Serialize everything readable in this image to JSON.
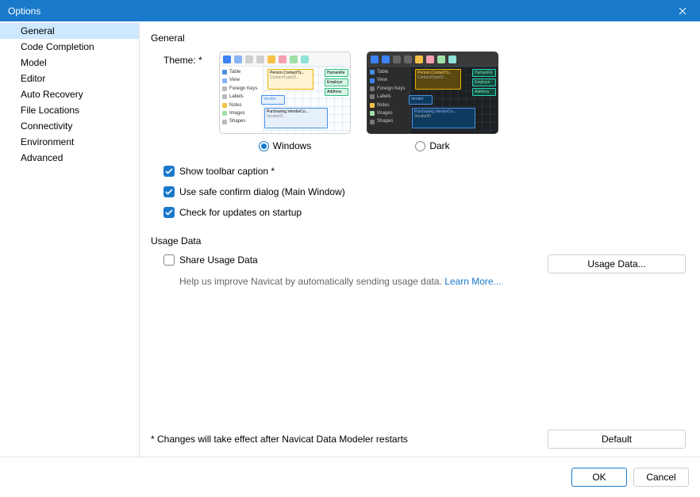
{
  "window": {
    "title": "Options"
  },
  "sidebar": {
    "items": [
      {
        "label": "General"
      },
      {
        "label": "Code Completion"
      },
      {
        "label": "Model"
      },
      {
        "label": "Editor"
      },
      {
        "label": "Auto Recovery"
      },
      {
        "label": "File Locations"
      },
      {
        "label": "Connectivity"
      },
      {
        "label": "Environment"
      },
      {
        "label": "Advanced"
      }
    ],
    "selected_index": 0
  },
  "general": {
    "section_title": "General",
    "theme_label": "Theme: *",
    "themes": {
      "windows": {
        "label": "Windows",
        "selected": true
      },
      "dark": {
        "label": "Dark",
        "selected": false
      }
    },
    "checkboxes": {
      "toolbar_caption": {
        "label": "Show toolbar caption *",
        "checked": true
      },
      "safe_confirm": {
        "label": "Use safe confirm dialog (Main Window)",
        "checked": true
      },
      "check_updates": {
        "label": "Check for updates on startup",
        "checked": true
      }
    }
  },
  "usage": {
    "section_title": "Usage Data",
    "share_label": "Share Usage Data",
    "share_checked": false,
    "hint_prefix": "Help us improve Navicat by automatically sending usage data. ",
    "learn_more": "Learn More...",
    "button_label": "Usage Data..."
  },
  "footer": {
    "restart_note": "* Changes will take effect after Navicat Data Modeler restarts",
    "default_btn": "Default",
    "ok_btn": "OK",
    "cancel_btn": "Cancel"
  },
  "preview_side_items": [
    "Table",
    "View",
    "Foreign Keys",
    "Labels",
    "Notes",
    "Images",
    "Shapes"
  ]
}
